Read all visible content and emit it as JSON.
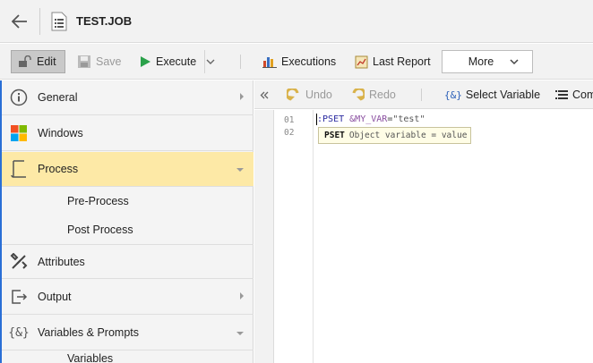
{
  "window": {
    "title": "TEST.JOB"
  },
  "toolbar": {
    "edit_label": "Edit",
    "save_label": "Save",
    "execute_label": "Execute",
    "executions_label": "Executions",
    "last_report_label": "Last Report",
    "more_label": "More"
  },
  "sidebar": {
    "items": [
      {
        "label": "General",
        "icon": "info-icon"
      },
      {
        "label": "Windows",
        "icon": "windows-logo-icon"
      },
      {
        "label": "Process",
        "icon": "process-icon"
      },
      {
        "label": "Attributes",
        "icon": "tools-icon"
      },
      {
        "label": "Output",
        "icon": "output-icon"
      },
      {
        "label": "Variables & Prompts",
        "icon": "variables-icon"
      }
    ],
    "process_sub": [
      "Pre-Process",
      "Post Process"
    ],
    "variables_sub_partial": "Variables"
  },
  "editor_toolbar": {
    "undo_label": "Undo",
    "redo_label": "Redo",
    "select_variable_label": "Select Variable",
    "comment_label_partial": "Com"
  },
  "editor": {
    "line_numbers": [
      "01",
      "02"
    ],
    "line1": {
      "colon": ":",
      "keyword": "PSET",
      "variable": "&MY_VAR",
      "equals": "=",
      "string": "\"test\""
    },
    "tooltip": {
      "keyword": "PSET",
      "signature": "Object variable = value"
    }
  },
  "colors": {
    "accent": "#2a6fd6",
    "active_item": "#fde9a6"
  }
}
